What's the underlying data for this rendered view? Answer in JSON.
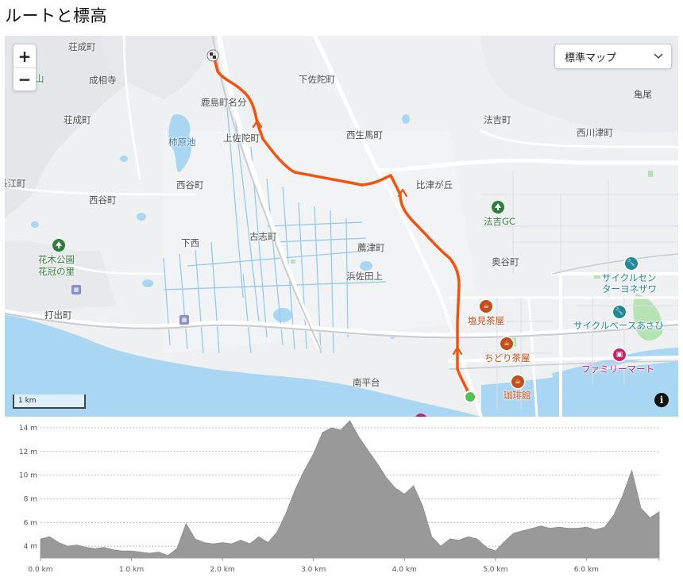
{
  "page": {
    "title": "ルートと標高"
  },
  "map": {
    "zoom_in_label": "+",
    "zoom_out_label": "−",
    "layer_select": {
      "value": "標準マップ"
    },
    "scale_label": "1 km",
    "info_label": "i",
    "labels": {
      "shojo_n": "荘成町",
      "seisoji": "成相寺",
      "shimosadacho": "下佐陀町",
      "kamio": "亀尾",
      "kashimacho_nabun": "鹿島町名分",
      "shojo_s": "荘成町",
      "kakinoharaike": "柿原池",
      "kamisadacho": "上佐陀町",
      "nishiikumacho": "西生馬町",
      "hokkicho": "法吉町",
      "nishikawatsucho": "西川津町",
      "nagaecho": "長江町",
      "nishitanicho": "西谷町",
      "nishimacho": "西谷町",
      "hitsugaoka": "比津が丘",
      "hokki_gc": "法吉GC",
      "shimonishi": "下西",
      "koshicho": "古志町",
      "komotsucho": "薦津町",
      "okudanicho": "奥谷町",
      "hanakikoen": "花木公園",
      "hanakanmuri": "花冠の里",
      "hamasadaue": "浜佐田上",
      "cycle_center": "サイクルセン",
      "cycle_center2": "ターヨネザワ",
      "uchidecho": "打出町",
      "shiomichaya": "塩見茶屋",
      "cycle_base": "サイクルベースあさひ",
      "chidorichaya": "ちどり茶屋",
      "familymart": "ファミリーマート",
      "minamihiradai": "南平台",
      "kohikan": "珈琲館",
      "mountain_partial": "山"
    },
    "icons": {
      "park": "tree-icon",
      "cafe": "cafe-icon",
      "bike_shop": "wrench-icon",
      "convenience": "shopping-bag-icon",
      "start": "start-marker",
      "end": "end-marker",
      "direction": "direction-arrow-icon"
    },
    "colors": {
      "route": "#f2540d",
      "water": "#a9d7f3",
      "park": "#b7e3b3",
      "start": "#52c152",
      "cafe": "#c24d16",
      "bike": "#1f8a96",
      "shop": "#c0246a"
    }
  },
  "elevation": {
    "y_ticks": [
      "14 m",
      "12 m",
      "10 m",
      "8 m",
      "6 m",
      "4 m"
    ],
    "x_ticks": [
      "0.0 km",
      "1.0 km",
      "2.0 km",
      "3.0 km",
      "4.0 km",
      "5.0 km",
      "6.0 km"
    ]
  },
  "chart_data": {
    "type": "area",
    "title": "",
    "xlabel": "",
    "ylabel": "",
    "xlim": [
      0,
      6.8
    ],
    "ylim": [
      3,
      14.6
    ],
    "x_unit": "km",
    "y_unit": "m",
    "grid": true,
    "series": [
      {
        "x": [
          0.0,
          0.1,
          0.2,
          0.3,
          0.4,
          0.5,
          0.6,
          0.7,
          0.8,
          0.9,
          1.0,
          1.1,
          1.2,
          1.3,
          1.4,
          1.5,
          1.6,
          1.7,
          1.8,
          1.9,
          2.0,
          2.1,
          2.2,
          2.3,
          2.4,
          2.5,
          2.6,
          2.7,
          2.8,
          2.9,
          3.0,
          3.1,
          3.2,
          3.3,
          3.4,
          3.5,
          3.6,
          3.7,
          3.8,
          3.9,
          4.0,
          4.1,
          4.2,
          4.3,
          4.4,
          4.5,
          4.6,
          4.7,
          4.8,
          4.9,
          5.0,
          5.1,
          5.2,
          5.3,
          5.4,
          5.5,
          5.6,
          5.7,
          5.8,
          5.9,
          6.0,
          6.1,
          6.2,
          6.3,
          6.4,
          6.5,
          6.6,
          6.7,
          6.8
        ],
        "values": [
          4.6,
          4.8,
          4.3,
          4.0,
          4.1,
          3.9,
          3.8,
          3.9,
          3.7,
          3.6,
          3.6,
          3.5,
          3.4,
          3.5,
          3.2,
          3.8,
          5.9,
          4.6,
          4.3,
          4.2,
          4.3,
          4.2,
          4.5,
          4.2,
          4.8,
          4.3,
          5.2,
          6.8,
          8.8,
          10.4,
          11.8,
          13.6,
          14.0,
          13.8,
          14.6,
          13.2,
          12.1,
          11.0,
          9.8,
          8.9,
          8.4,
          9.1,
          7.4,
          4.8,
          4.0,
          4.6,
          4.5,
          4.8,
          4.6,
          3.9,
          3.6,
          4.4,
          5.1,
          5.3,
          5.5,
          5.7,
          5.5,
          5.6,
          5.5,
          5.5,
          5.6,
          5.4,
          5.6,
          6.6,
          8.3,
          10.4,
          7.2,
          6.4,
          6.9
        ],
        "color": "#999999"
      }
    ]
  }
}
